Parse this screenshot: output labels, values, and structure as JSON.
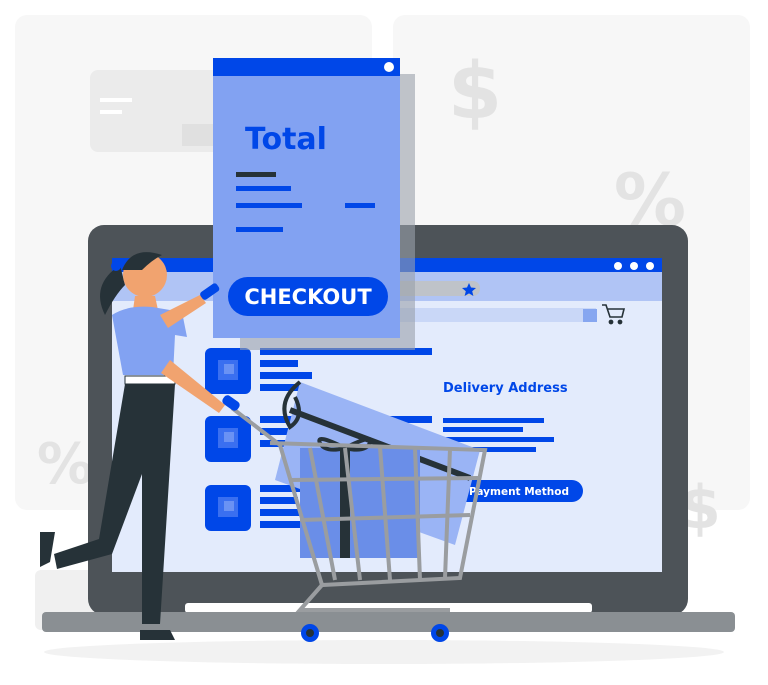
{
  "receipt": {
    "title": "Total",
    "checkout_label": "CHECKOUT"
  },
  "screen": {
    "delivery_heading": "Delivery Address",
    "payment_button_label": "Payment Method"
  },
  "decor": {
    "dollar_sign": "$",
    "percent_sign": "%"
  },
  "colors": {
    "brand_blue": "#0047e8",
    "light_blue": "#82a2f2",
    "screen_bg": "#e3ebfc",
    "laptop_frame": "#4d5358",
    "dark": "#263238"
  },
  "icons": [
    "star-icon",
    "cart-icon",
    "window-dots-icon"
  ]
}
